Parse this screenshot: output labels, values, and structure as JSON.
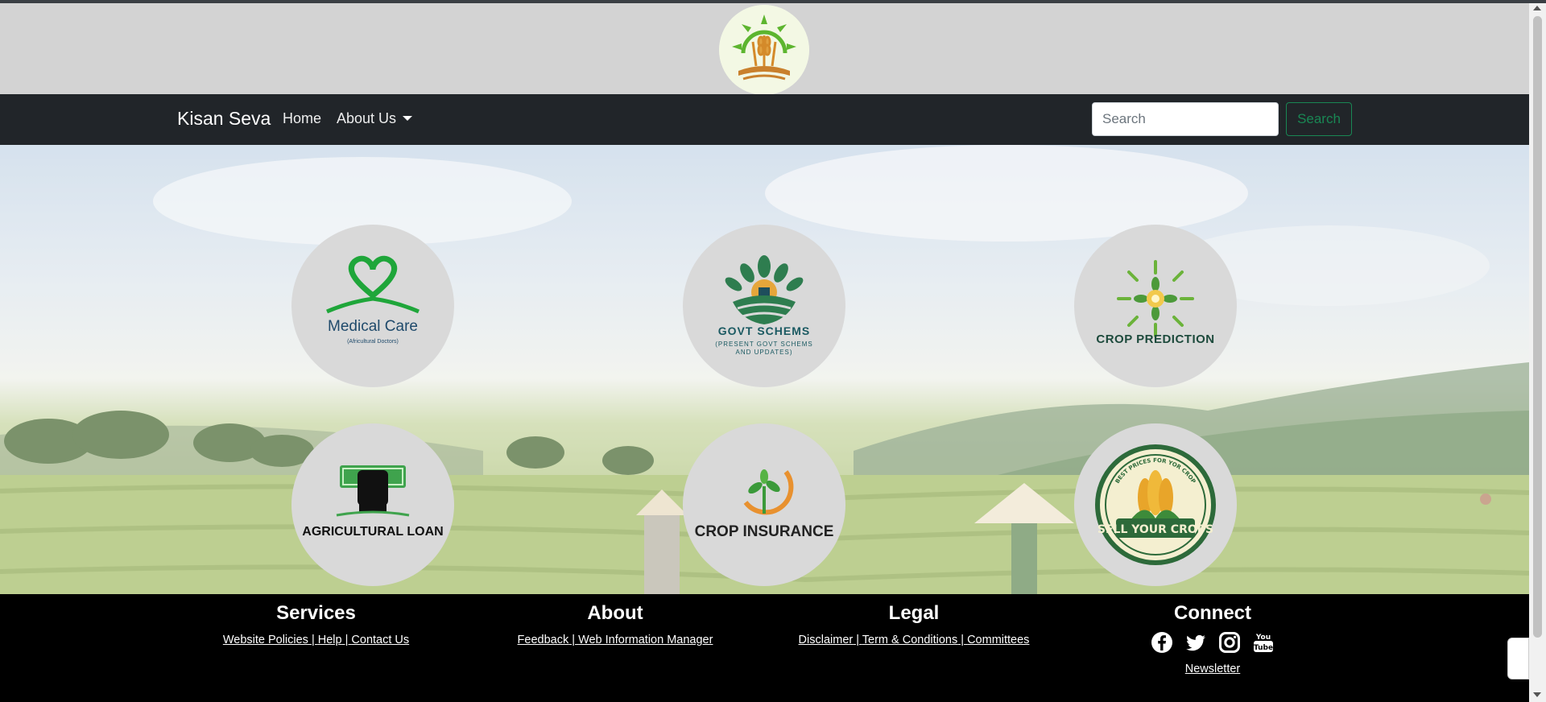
{
  "navbar": {
    "brand": "Kisan Seva",
    "home_label": "Home",
    "about_label": "About Us",
    "search_placeholder": "Search",
    "search_button": "Search"
  },
  "services": {
    "medical": {
      "title": "Medical Care",
      "subtitle": "(Africultural Doctors)"
    },
    "govt": {
      "title": "GOVT SCHEMS",
      "subtitle": "(PRESENT GOVT SCHEMS AND UPDATES)"
    },
    "crop_prediction": {
      "title": "CROP PREDICTION"
    },
    "loan": {
      "title": "AGRICULTURAL LOAN"
    },
    "insurance": {
      "title": "CROP INSURANCE"
    },
    "sell": {
      "title": "SELL YOUR CROPS",
      "arc_text": "BEST PRICES FOR YOR CROP"
    }
  },
  "footer": {
    "services": {
      "heading": "Services",
      "links": [
        "Website Policies",
        "Help",
        "Contact Us"
      ]
    },
    "about": {
      "heading": "About",
      "links": [
        "Feedback",
        "Web Information Manager"
      ]
    },
    "legal": {
      "heading": "Legal",
      "links": [
        "Disclaimer",
        "Term & Conditions",
        "Committees"
      ]
    },
    "connect": {
      "heading": "Connect",
      "icons": [
        "facebook-icon",
        "twitter-icon",
        "instagram-icon",
        "youtube-icon"
      ],
      "youtube_text": "You Tube",
      "newsletter": "Newsletter"
    }
  },
  "colors": {
    "navbar": "#212529",
    "brand_strip": "#d3d3d3",
    "footer": "#000000",
    "search_accent": "#198754",
    "tile": "#d9d9d9"
  }
}
